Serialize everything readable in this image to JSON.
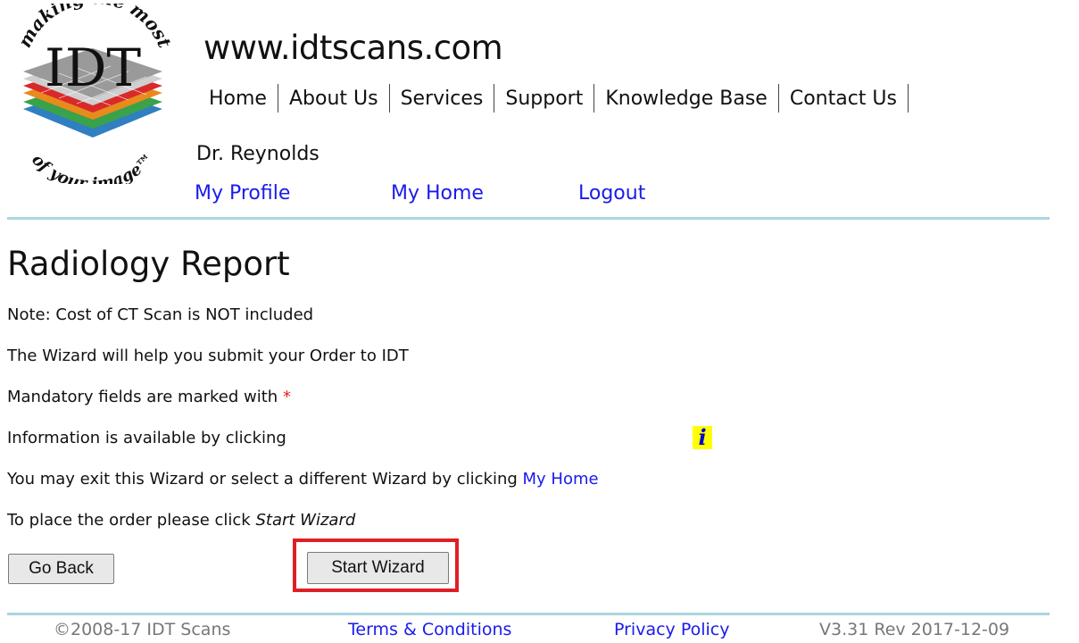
{
  "header": {
    "logo": {
      "text": "IDT",
      "tagline_top": "making the most",
      "tagline_bottom": "of your image™"
    },
    "site_url": "www.idtscans.com",
    "nav": [
      {
        "label": "Home"
      },
      {
        "label": "About Us"
      },
      {
        "label": "Services"
      },
      {
        "label": "Support"
      },
      {
        "label": "Knowledge Base"
      },
      {
        "label": "Contact Us"
      }
    ],
    "user_name": "Dr. Reynolds",
    "user_links": {
      "profile": "My Profile",
      "home": "My Home",
      "logout": "Logout"
    }
  },
  "main": {
    "title": "Radiology Report",
    "note": "Note: Cost of CT Scan is NOT included",
    "wizard_help": "The Wizard will help you submit your Order to IDT",
    "mandatory_text": "Mandatory fields are marked with",
    "mandatory_marker": "*",
    "info_text": "Information is available by clicking",
    "info_icon": "i",
    "exit_text": "You may exit this Wizard or select a different Wizard by clicking",
    "exit_link": "My Home",
    "place_text": "To place the order please click",
    "place_em": "Start Wizard",
    "buttons": {
      "back": "Go Back",
      "start": "Start Wizard"
    }
  },
  "footer": {
    "copyright": "©2008-17 IDT Scans",
    "terms": "Terms & Conditions",
    "privacy": "Privacy Policy",
    "version": "V3.31 Rev 2017-12-09"
  },
  "colors": {
    "link": "#1a1aee",
    "divider": "#a9d6e0",
    "required": "#e0241c",
    "highlight": "#e01e25",
    "info_bg": "#ffff00"
  }
}
